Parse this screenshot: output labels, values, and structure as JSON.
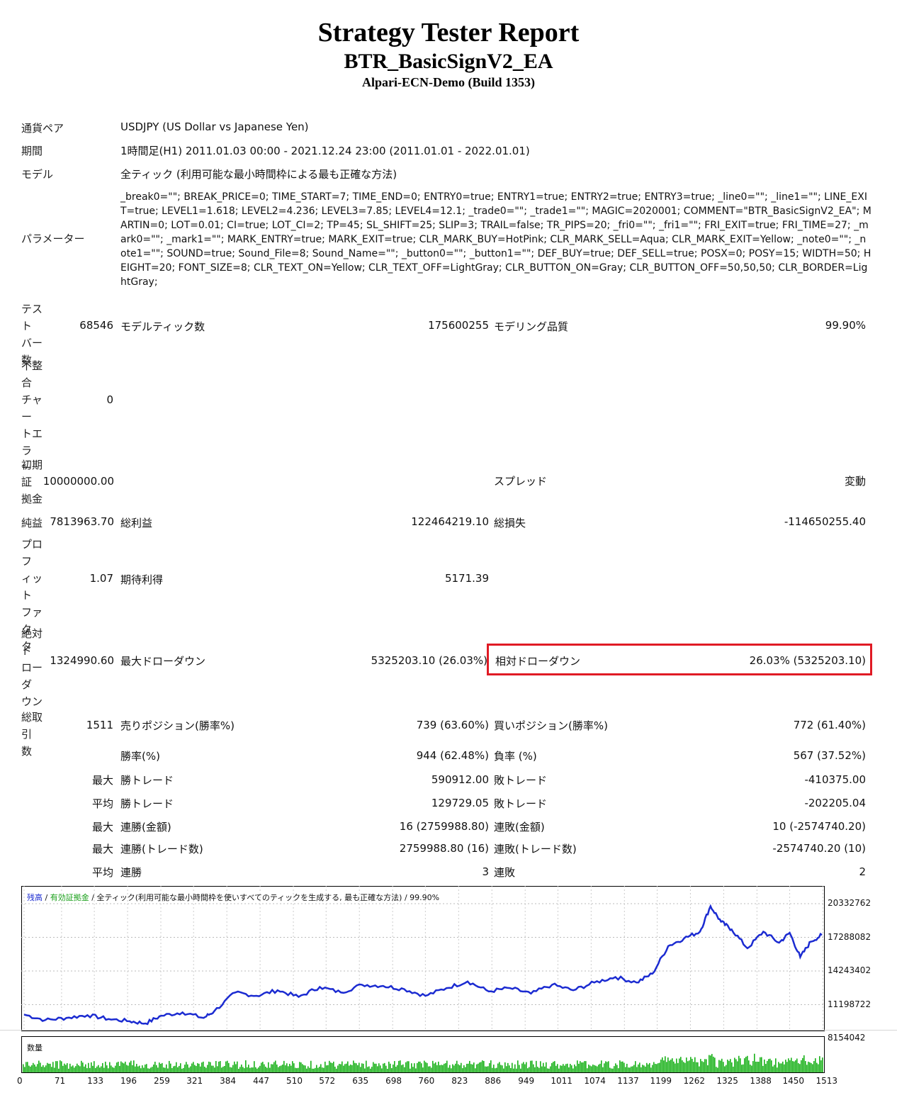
{
  "header": {
    "title": "Strategy Tester Report",
    "ea_name": "BTR_BasicSignV2_EA",
    "server": "Alpari-ECN-Demo (Build 1353)"
  },
  "info": {
    "pair_label": "通貨ペア",
    "pair_value": "USDJPY (US Dollar vs Japanese Yen)",
    "period_label": "期間",
    "period_value": "1時間足(H1) 2011.01.03 00:00 - 2021.12.24 23:00 (2011.01.01 - 2022.01.01)",
    "model_label": "モデル",
    "model_value": "全ティック (利用可能な最小時間枠による最も正確な方法)",
    "params_label": "パラメーター",
    "params_value": "_break0=\"\"; BREAK_PRICE=0; TIME_START=7; TIME_END=0; ENTRY0=true; ENTRY1=true; ENTRY2=true; ENTRY3=true; _line0=\"\"; _line1=\"\"; LINE_EXIT=true; LEVEL1=1.618; LEVEL2=4.236; LEVEL3=7.85; LEVEL4=12.1; _trade0=\"\"; _trade1=\"\"; MAGIC=2020001; COMMENT=\"BTR_BasicSignV2_EA\"; MARTIN=0; LOT=0.01; CI=true; LOT_CI=2; TP=45; SL_SHIFT=25; SLIP=3; TRAIL=false; TR_PIPS=20; _fri0=\"\"; _fri1=\"\"; FRI_EXIT=true; FRI_TIME=27; _mark0=\"\"; _mark1=\"\"; MARK_ENTRY=true; MARK_EXIT=true; CLR_MARK_BUY=HotPink; CLR_MARK_SELL=Aqua; CLR_MARK_EXIT=Yellow; _note0=\"\"; _note1=\"\"; SOUND=true; Sound_File=8; Sound_Name=\"\"; _button0=\"\"; _button1=\"\"; DEF_BUY=true; DEF_SELL=true; POSX=0; POSY=15; WIDTH=50; HEIGHT=20; FONT_SIZE=8; CLR_TEXT_ON=Yellow; CLR_TEXT_OFF=LightGray; CLR_BUTTON_ON=Gray; CLR_BUTTON_OFF=50,50,50; CLR_BORDER=LightGray;"
  },
  "stats": {
    "bars_label": "テストバー数",
    "bars_value": "68546",
    "ticks_label": "モデルティック数",
    "ticks_value": "175600255",
    "quality_label": "モデリング品質",
    "quality_value": "99.90%",
    "mismatch_label": "不整合チャートエラー",
    "mismatch_value": "0",
    "deposit_label": "初期証拠金",
    "deposit_value": "10000000.00",
    "spread_label": "スプレッド",
    "spread_value": "変動",
    "net_label": "純益",
    "net_value": "7813963.70",
    "gross_profit_label": "総利益",
    "gross_profit_value": "122464219.10",
    "gross_loss_label": "総損失",
    "gross_loss_value": "-114650255.40",
    "pf_label": "プロフィットファクタ",
    "pf_value": "1.07",
    "expected_label": "期待利得",
    "expected_value": "5171.39",
    "abs_dd_label": "絶対ドローダウン",
    "abs_dd_value": "1324990.60",
    "max_dd_label": "最大ドローダウン",
    "max_dd_value": "5325203.10 (26.03%)",
    "rel_dd_label": "相対ドローダウン",
    "rel_dd_value": "26.03% (5325203.10)",
    "total_trades_label": "総取引数",
    "total_trades_value": "1511",
    "short_label": "売りポジション(勝率%)",
    "short_value": "739 (63.60%)",
    "long_label": "買いポジション(勝率%)",
    "long_value": "772 (61.40%)",
    "win_rate_label": "勝率(%)",
    "win_rate_value": "944 (62.48%)",
    "loss_rate_label": "負率 (%)",
    "loss_rate_value": "567 (37.52%)",
    "max_prefix": "最大",
    "avg_prefix": "平均",
    "largest_win_label": "勝トレード",
    "largest_win_value": "590912.00",
    "largest_loss_label": "敗トレード",
    "largest_loss_value": "-410375.00",
    "avg_win_label": "勝トレード",
    "avg_win_value": "129729.05",
    "avg_loss_label": "敗トレード",
    "avg_loss_value": "-202205.04",
    "consec_wins_amt_label": "連勝(金額)",
    "consec_wins_amt_value": "16 (2759988.80)",
    "consec_losses_amt_label": "連敗(金額)",
    "consec_losses_amt_value": "10 (-2574740.20)",
    "consec_wins_cnt_label": "連勝(トレード数)",
    "consec_wins_cnt_value": "2759988.80 (16)",
    "consec_losses_cnt_label": "連敗(トレード数)",
    "consec_losses_cnt_value": "-2574740.20 (10)",
    "avg_consec_wins_label": "連勝",
    "avg_consec_wins_value": "3",
    "avg_consec_losses_label": "連敗",
    "avg_consec_losses_value": "2"
  },
  "chart_legend": {
    "balance": "残高",
    "sep1": " / ",
    "equity": "有効証拠金",
    "sep2": " / ",
    "desc": "全ティック(利用可能な最小時間枠を使いすべてのティックを生成する, 最も正確な方法) / 99.90%",
    "volume": "数量"
  },
  "chart_data": {
    "type": "line",
    "ylim": [
      8154042,
      20332762
    ],
    "yticks": [
      "20332762",
      "17288082",
      "14243402",
      "11198722",
      "8154042"
    ],
    "xticks": [
      "0",
      "71",
      "133",
      "196",
      "259",
      "321",
      "384",
      "447",
      "510",
      "572",
      "635",
      "698",
      "760",
      "823",
      "886",
      "949",
      "1011",
      "1074",
      "1137",
      "1199",
      "1262",
      "1325",
      "1388",
      "1450",
      "1513"
    ],
    "xlim": [
      0,
      1511
    ],
    "series": [
      {
        "name": "残高",
        "color": "#1b2bd1",
        "x": [
          0,
          40,
          80,
          120,
          160,
          200,
          230,
          260,
          300,
          340,
          360,
          400,
          440,
          480,
          520,
          560,
          600,
          640,
          680,
          720,
          760,
          800,
          840,
          880,
          920,
          960,
          1000,
          1040,
          1080,
          1120,
          1160,
          1190,
          1220,
          1250,
          1280,
          1300,
          1320,
          1340,
          1370,
          1400,
          1430,
          1450,
          1470,
          1490,
          1511
        ],
        "values": [
          10300000,
          9800000,
          10000000,
          10250000,
          9900000,
          9700000,
          9500000,
          10200000,
          10500000,
          10000000,
          10600000,
          12300000,
          12000000,
          12500000,
          11900000,
          12800000,
          12300000,
          13000000,
          12900000,
          12600000,
          12000000,
          12700000,
          13300000,
          12400000,
          12700000,
          12200000,
          13000000,
          12500000,
          13200000,
          13700000,
          13200000,
          14000000,
          16500000,
          17200000,
          17800000,
          20100000,
          18700000,
          18000000,
          16300000,
          17800000,
          16800000,
          17700000,
          15500000,
          16900000,
          17500000
        ]
      }
    ],
    "volume_color": "#19b119"
  },
  "colors": {
    "highlight": "#e01a24",
    "balance": "#1b2bd1",
    "volume": "#19b119"
  }
}
